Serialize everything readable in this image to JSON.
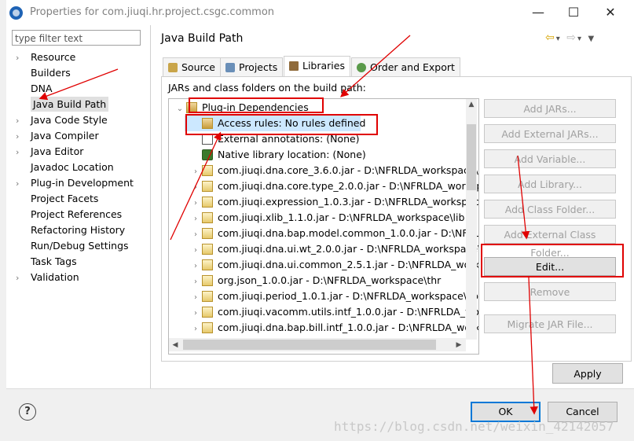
{
  "window": {
    "title": "Properties for com.jiuqi.hr.project.csgc.common",
    "minimize": "—",
    "maximize": "☐",
    "close": "✕"
  },
  "sidebar": {
    "filter_placeholder": "type filter text",
    "items": [
      {
        "label": "Resource",
        "expandable": true
      },
      {
        "label": "Builders",
        "expandable": false
      },
      {
        "label": "DNA",
        "expandable": false
      },
      {
        "label": "Java Build Path",
        "expandable": false,
        "selected": true
      },
      {
        "label": "Java Code Style",
        "expandable": true
      },
      {
        "label": "Java Compiler",
        "expandable": true
      },
      {
        "label": "Java Editor",
        "expandable": true
      },
      {
        "label": "Javadoc Location",
        "expandable": false
      },
      {
        "label": "Plug-in Development",
        "expandable": true
      },
      {
        "label": "Project Facets",
        "expandable": false
      },
      {
        "label": "Project References",
        "expandable": false
      },
      {
        "label": "Refactoring History",
        "expandable": false
      },
      {
        "label": "Run/Debug Settings",
        "expandable": false
      },
      {
        "label": "Task Tags",
        "expandable": false
      },
      {
        "label": "Validation",
        "expandable": true
      }
    ]
  },
  "page": {
    "title": "Java Build Path",
    "tabs": [
      {
        "label": "Source",
        "icon": "source-folder-icon"
      },
      {
        "label": "Projects",
        "icon": "projects-icon"
      },
      {
        "label": "Libraries",
        "icon": "libraries-icon",
        "active": true
      },
      {
        "label": "Order and Export",
        "icon": "order-export-icon"
      }
    ],
    "jars_label": "JARs and class folders on the build path:",
    "tree": [
      {
        "label": "Plug-in Dependencies",
        "indent": 0,
        "arrow": "expanded",
        "icon": "acc"
      },
      {
        "label": "Access rules: No rules defined",
        "indent": 1,
        "arrow": "none",
        "icon": "acc",
        "selected": true
      },
      {
        "label": "External annotations: (None)",
        "indent": 1,
        "arrow": "none",
        "icon": "ann"
      },
      {
        "label": "Native library location: (None)",
        "indent": 1,
        "arrow": "none",
        "icon": "nat"
      },
      {
        "label": "com.jiuqi.dna.core_3.6.0.jar - D:\\NFRLDA_workspace\\d",
        "indent": 1,
        "arrow": "collapsed",
        "icon": "jar"
      },
      {
        "label": "com.jiuqi.dna.core.type_2.0.0.jar - D:\\NFRLDA_worksp",
        "indent": 1,
        "arrow": "collapsed",
        "icon": "jar"
      },
      {
        "label": "com.jiuqi.expression_1.0.3.jar - D:\\NFRLDA_workspace",
        "indent": 1,
        "arrow": "collapsed",
        "icon": "jar"
      },
      {
        "label": "com.jiuqi.xlib_1.1.0.jar - D:\\NFRLDA_workspace\\lib",
        "indent": 1,
        "arrow": "collapsed",
        "icon": "jar"
      },
      {
        "label": "com.jiuqi.dna.bap.model.common_1.0.0.jar - D:\\NFRLD",
        "indent": 1,
        "arrow": "collapsed",
        "icon": "jar"
      },
      {
        "label": "com.jiuqi.dna.ui.wt_2.0.0.jar - D:\\NFRLDA_workspace\\",
        "indent": 1,
        "arrow": "collapsed",
        "icon": "jar"
      },
      {
        "label": "com.jiuqi.dna.ui.common_2.5.1.jar - D:\\NFRLDA_worksp",
        "indent": 1,
        "arrow": "collapsed",
        "icon": "jar"
      },
      {
        "label": "org.json_1.0.0.jar - D:\\NFRLDA_workspace\\thr",
        "indent": 1,
        "arrow": "collapsed",
        "icon": "jar"
      },
      {
        "label": "com.jiuqi.period_1.0.1.jar - D:\\NFRLDA_workspace\\lib",
        "indent": 1,
        "arrow": "collapsed",
        "icon": "jar"
      },
      {
        "label": "com.jiuqi.vacomm.utils.intf_1.0.0.jar - D:\\NFRLDA_work",
        "indent": 1,
        "arrow": "collapsed",
        "icon": "jar"
      },
      {
        "label": "com.jiuqi.dna.bap.bill.intf_1.0.0.jar - D:\\NFRLDA_works",
        "indent": 1,
        "arrow": "collapsed",
        "icon": "jar"
      }
    ],
    "buttons": [
      {
        "label": "Add JARs...",
        "enabled": false
      },
      {
        "label": "Add External JARs...",
        "enabled": false
      },
      {
        "label": "Add Variable...",
        "enabled": false
      },
      {
        "label": "Add Library...",
        "enabled": false
      },
      {
        "label": "Add Class Folder...",
        "enabled": false
      },
      {
        "label": "Add External Class Folder...",
        "enabled": false
      },
      {
        "label": "Edit...",
        "enabled": true
      },
      {
        "label": "Remove",
        "enabled": false
      },
      {
        "label": "Migrate JAR File...",
        "enabled": false
      }
    ],
    "apply_label": "Apply"
  },
  "footer": {
    "help": "?",
    "ok_label": "OK",
    "cancel_label": "Cancel"
  },
  "watermark": "https://blog.csdn.net/weixin_42142057",
  "colors": {
    "annotation": "#e00000",
    "selection": "#cce8ff",
    "focus": "#0078d7"
  }
}
